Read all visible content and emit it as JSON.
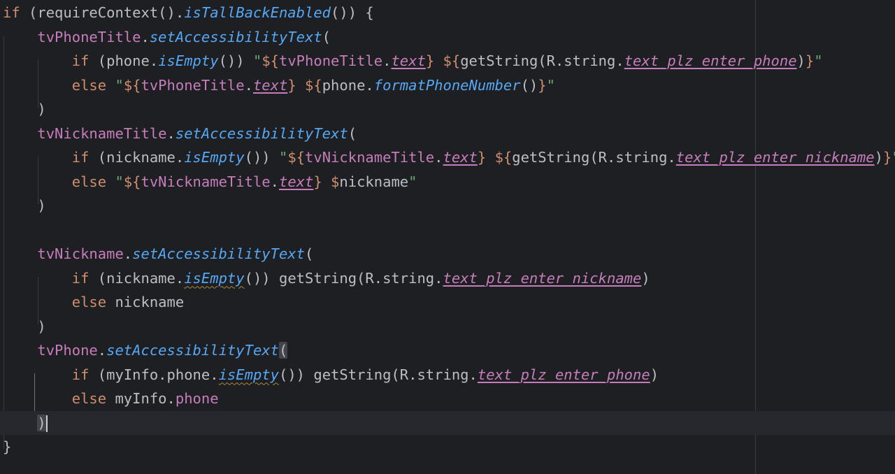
{
  "editor": {
    "lines": [
      [
        [
          "kw",
          "if"
        ],
        [
          "plain",
          " (requireContext()."
        ],
        [
          "fn-italic",
          "isTallBackEnabled"
        ],
        [
          "plain",
          "()) {"
        ]
      ],
      [
        [
          "plain",
          "    "
        ],
        [
          "prop",
          "tvPhoneTitle"
        ],
        [
          "plain",
          "."
        ],
        [
          "fn-italic",
          "setAccessibilityText"
        ],
        [
          "plain",
          "("
        ]
      ],
      [
        [
          "plain",
          "        "
        ],
        [
          "kw",
          "if"
        ],
        [
          "plain",
          " (phone."
        ],
        [
          "fn-italic",
          "isEmpty"
        ],
        [
          "plain",
          "()) "
        ],
        [
          "str",
          "\""
        ],
        [
          "tmpl",
          "${"
        ],
        [
          "prop",
          "tvPhoneTitle"
        ],
        [
          "plain",
          "."
        ],
        [
          "prop-italic-u",
          "text"
        ],
        [
          "tmpl",
          "}"
        ],
        [
          "str",
          " "
        ],
        [
          "tmpl",
          "${"
        ],
        [
          "plain",
          "getString(R.string."
        ],
        [
          "prop-italic-u",
          "text_plz_enter_phone"
        ],
        [
          "plain",
          ")"
        ],
        [
          "tmpl",
          "}"
        ],
        [
          "str",
          "\""
        ]
      ],
      [
        [
          "plain",
          "        "
        ],
        [
          "kw",
          "else"
        ],
        [
          "plain",
          " "
        ],
        [
          "str",
          "\""
        ],
        [
          "tmpl",
          "${"
        ],
        [
          "prop",
          "tvPhoneTitle"
        ],
        [
          "plain",
          "."
        ],
        [
          "prop-italic-u",
          "text"
        ],
        [
          "tmpl",
          "}"
        ],
        [
          "str",
          " "
        ],
        [
          "tmpl",
          "${"
        ],
        [
          "plain",
          "phone."
        ],
        [
          "fn-italic",
          "formatPhoneNumber"
        ],
        [
          "plain",
          "()"
        ],
        [
          "tmpl",
          "}"
        ],
        [
          "str",
          "\""
        ]
      ],
      [
        [
          "plain",
          "    )"
        ]
      ],
      [
        [
          "plain",
          "    "
        ],
        [
          "prop",
          "tvNicknameTitle"
        ],
        [
          "plain",
          "."
        ],
        [
          "fn-italic",
          "setAccessibilityText"
        ],
        [
          "plain",
          "("
        ]
      ],
      [
        [
          "plain",
          "        "
        ],
        [
          "kw",
          "if"
        ],
        [
          "plain",
          " (nickname."
        ],
        [
          "fn-italic",
          "isEmpty"
        ],
        [
          "plain",
          "()) "
        ],
        [
          "str",
          "\""
        ],
        [
          "tmpl",
          "${"
        ],
        [
          "prop",
          "tvNicknameTitle"
        ],
        [
          "plain",
          "."
        ],
        [
          "prop-italic-u",
          "text"
        ],
        [
          "tmpl",
          "}"
        ],
        [
          "str",
          " "
        ],
        [
          "tmpl",
          "${"
        ],
        [
          "plain",
          "getString(R.string."
        ],
        [
          "prop-italic-u",
          "text_plz_enter_nickname"
        ],
        [
          "plain",
          ")"
        ],
        [
          "tmpl",
          "}"
        ],
        [
          "str",
          "\""
        ]
      ],
      [
        [
          "plain",
          "        "
        ],
        [
          "kw",
          "else"
        ],
        [
          "plain",
          " "
        ],
        [
          "str",
          "\""
        ],
        [
          "tmpl",
          "${"
        ],
        [
          "prop",
          "tvNicknameTitle"
        ],
        [
          "plain",
          "."
        ],
        [
          "prop-italic-u",
          "text"
        ],
        [
          "tmpl",
          "}"
        ],
        [
          "str",
          " "
        ],
        [
          "tmpl",
          "$"
        ],
        [
          "plain",
          "nickname"
        ],
        [
          "str",
          "\""
        ]
      ],
      [
        [
          "plain",
          "    )"
        ]
      ],
      [],
      [
        [
          "plain",
          "    "
        ],
        [
          "prop",
          "tvNickname"
        ],
        [
          "plain",
          "."
        ],
        [
          "fn-italic",
          "setAccessibilityText"
        ],
        [
          "plain",
          "("
        ]
      ],
      [
        [
          "plain",
          "        "
        ],
        [
          "kw",
          "if"
        ],
        [
          "plain",
          " (nickname."
        ],
        [
          "fn-italic-u",
          "isEmpty"
        ],
        [
          "plain",
          "()) getString(R.string."
        ],
        [
          "prop-italic-u",
          "text_plz_enter_nickname"
        ],
        [
          "plain",
          ")"
        ]
      ],
      [
        [
          "plain",
          "        "
        ],
        [
          "kw",
          "else"
        ],
        [
          "plain",
          " nickname"
        ]
      ],
      [
        [
          "plain",
          "    )"
        ]
      ],
      [
        [
          "plain",
          "    "
        ],
        [
          "prop",
          "tvPhone"
        ],
        [
          "plain",
          "."
        ],
        [
          "fn-italic",
          "setAccessibilityText"
        ],
        [
          "brace-match",
          "("
        ]
      ],
      [
        [
          "plain",
          "        "
        ],
        [
          "kw",
          "if"
        ],
        [
          "plain",
          " (myInfo.phone."
        ],
        [
          "fn-italic-u",
          "isEmpty"
        ],
        [
          "plain",
          "()) getString(R.string."
        ],
        [
          "prop-italic-u",
          "text_plz_enter_phone"
        ],
        [
          "plain",
          ")"
        ]
      ],
      [
        [
          "plain",
          "        "
        ],
        [
          "kw",
          "else"
        ],
        [
          "plain",
          " myInfo."
        ],
        [
          "prop",
          "phone"
        ]
      ],
      [
        [
          "plain",
          "    "
        ],
        [
          "brace-match",
          ")"
        ],
        [
          "caret",
          ""
        ]
      ],
      [
        [
          "plain",
          "}"
        ]
      ]
    ],
    "current_line_index": 17,
    "colors": {
      "background": "#1e1f22",
      "keyword": "#cf8e6d",
      "function": "#56a8f5",
      "property": "#c77dbb",
      "string": "#6aab73",
      "text": "#bcbec4"
    }
  }
}
